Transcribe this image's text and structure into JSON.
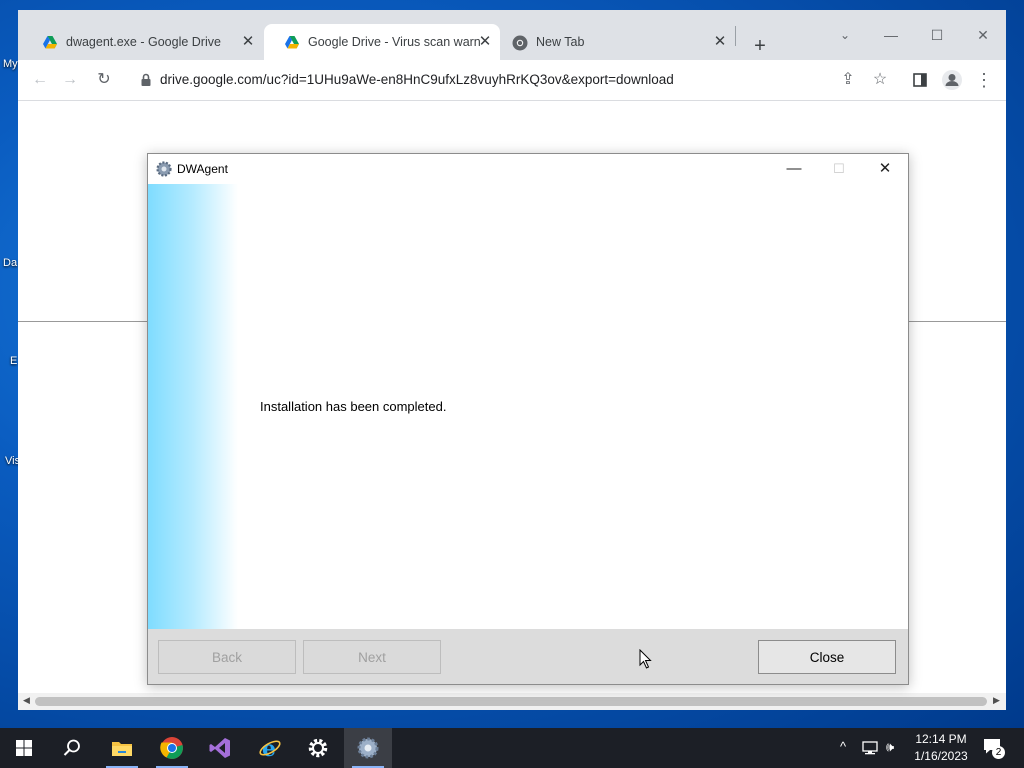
{
  "desktop": {
    "icons": [
      "My",
      "Da",
      "E",
      "Vis"
    ]
  },
  "browser": {
    "tabs": [
      {
        "title": "dwagent.exe - Google Drive",
        "active": false,
        "icon": "google-drive-icon"
      },
      {
        "title": "Google Drive - Virus scan warnin",
        "active": true,
        "icon": "google-drive-icon"
      },
      {
        "title": "New Tab",
        "active": false,
        "icon": "chrome-icon"
      }
    ],
    "url": "drive.google.com/uc?id=1UHu9aWe-en8HnC9ufxLz8vuyhRrKQ3ov&export=download"
  },
  "dialog": {
    "title": "DWAgent",
    "message": "Installation has been completed.",
    "buttons": {
      "back": "Back",
      "next": "Next",
      "close": "Close"
    }
  },
  "taskbar": {
    "apps": [
      "start-icon",
      "search-icon",
      "file-explorer-icon",
      "chrome-icon",
      "visual-studio-icon",
      "internet-explorer-icon",
      "settings-icon",
      "dwagent-icon"
    ],
    "clock": {
      "time": "12:14 PM",
      "date": "1/16/2023"
    },
    "notification_count": "2"
  },
  "colors": {
    "accent": "#1a73e8",
    "taskbar": "#1c1f26",
    "dialog_side": "#7fdcff"
  }
}
